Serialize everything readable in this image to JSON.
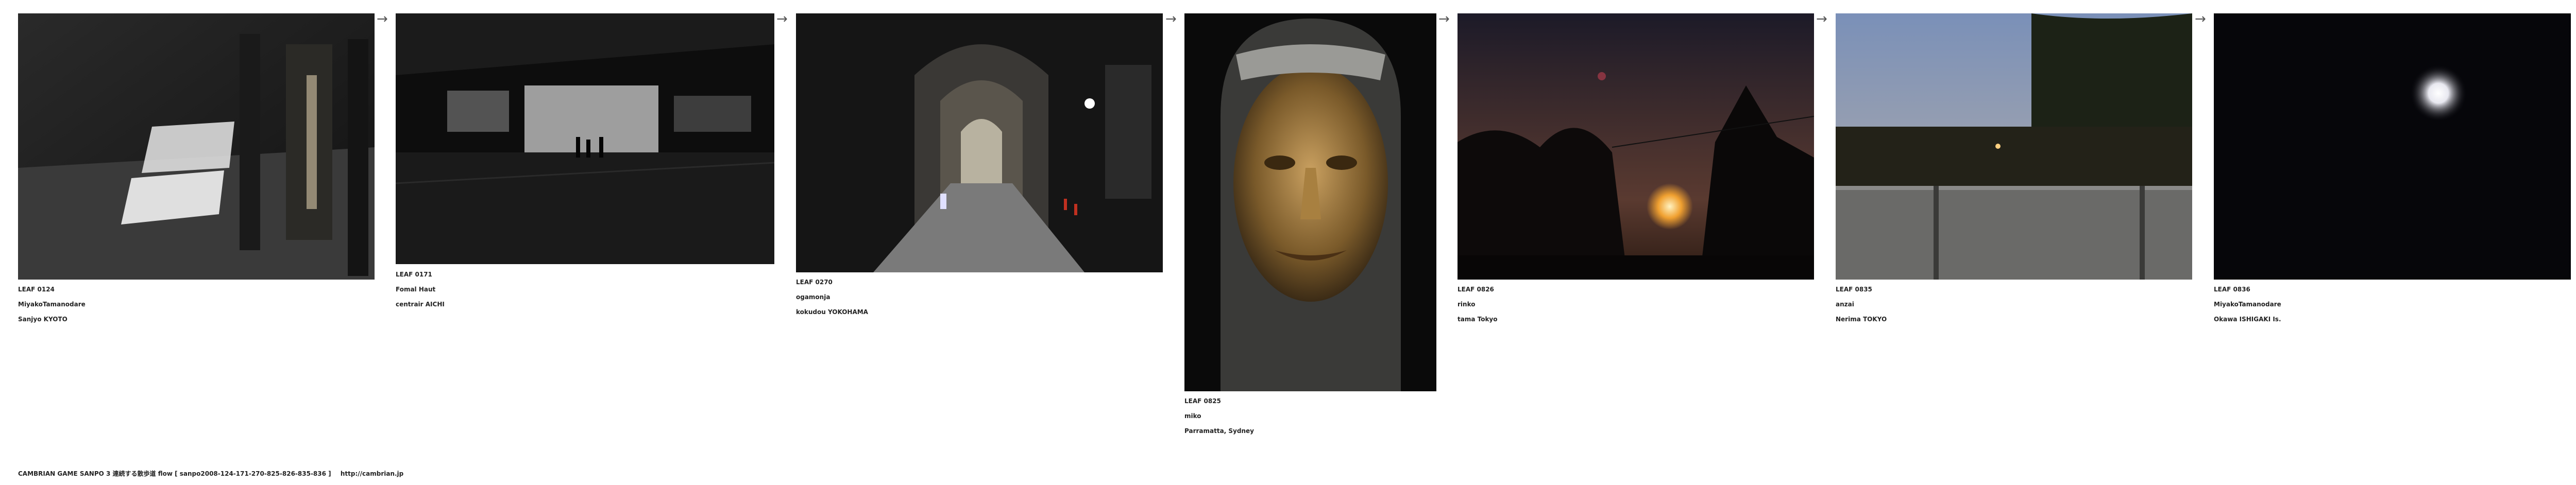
{
  "leaves": [
    {
      "id": "LEAF 0124",
      "author": "MiyakoTamanodare",
      "place": "Sanjyo KYOTO",
      "scene": "doorway-shadow"
    },
    {
      "id": "LEAF 0171",
      "author": "Fomal Haut",
      "place": "centrair AICHI",
      "scene": "terminal-silhouette"
    },
    {
      "id": "LEAF 0270",
      "author": "ogamonja",
      "place": "kokudou YOKOHAMA",
      "scene": "arcade-tunnel"
    },
    {
      "id": "LEAF 0825",
      "author": "miko",
      "place": "Parramatta, Sydney",
      "scene": "bronze-face"
    },
    {
      "id": "LEAF 0826",
      "author": "rinko",
      "place": "tama Tokyo",
      "scene": "sunset-trees"
    },
    {
      "id": "LEAF 0835",
      "author": "anzai",
      "place": "Nerima TOKYO",
      "scene": "dusk-wall"
    },
    {
      "id": "LEAF 0836",
      "author": "MiyakoTamanodare",
      "place": "Okawa ISHIGAKI Is.",
      "scene": "moon-night"
    }
  ],
  "arrow_glyph": "→",
  "footer": {
    "text": "CAMBRIAN GAME  SANPO 3 連続する散歩道 flow [ sanpo2008-124-171-270-825-826-835-836 ]",
    "link": "http://cambrian.jp"
  }
}
